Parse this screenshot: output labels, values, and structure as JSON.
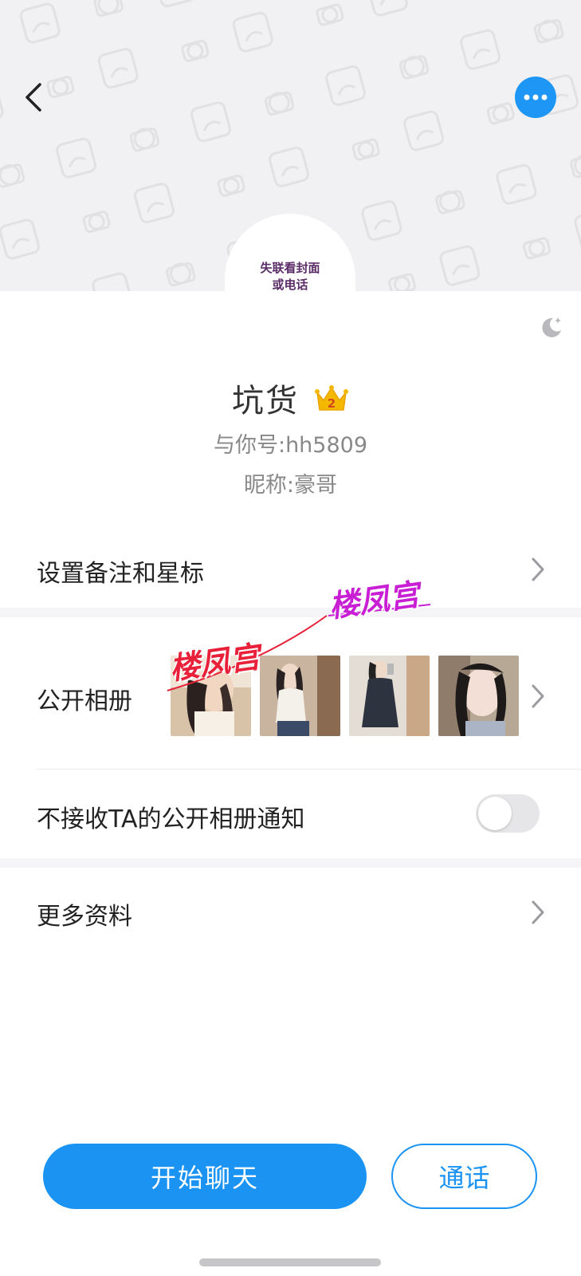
{
  "cover": {
    "avatar_text_line1": "失联看封面",
    "avatar_text_line2": "或电话"
  },
  "profile": {
    "name": "坑货",
    "vip_level": "2",
    "id_line": "与你号:hh5809",
    "nickname_line": "昵称:豪哥"
  },
  "menu": {
    "remark_label": "设置备注和星标",
    "album_label": "公开相册",
    "notify_label": "不接收TA的公开相册通知",
    "notify_toggle_on": false,
    "more_label": "更多资料"
  },
  "album": {
    "photos": [
      "photo-1",
      "photo-2",
      "photo-3",
      "photo-4"
    ]
  },
  "watermarks": [
    "楼凤宫",
    "楼凤宫"
  ],
  "actions": {
    "chat_label": "开始聊天",
    "call_label": "通话"
  },
  "colors": {
    "accent": "#1a93f3",
    "cover_bg": "#f1f1f3",
    "crown": "#f5b800"
  }
}
